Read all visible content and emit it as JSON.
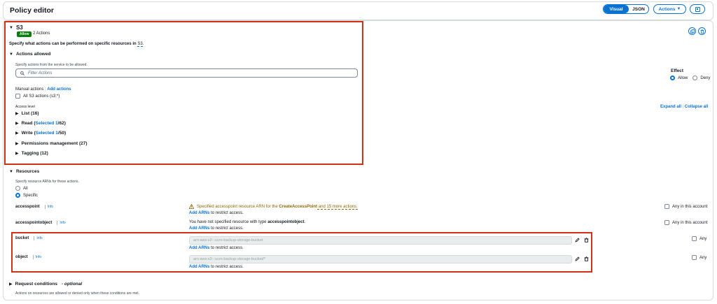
{
  "header": {
    "title": "Policy editor",
    "mode_visual": "Visual",
    "mode_json": "JSON",
    "actions_label": "Actions"
  },
  "service": {
    "name": "S3",
    "effect_badge": "Allow",
    "actions_count": "2 Actions",
    "description_prefix": "Specify what actions can be performed on specific resources in ",
    "description_service": "S3",
    "description_suffix": "."
  },
  "actions_allowed": {
    "heading": "Actions allowed",
    "hint": "Specify actions from the service to be allowed.",
    "filter_placeholder": "Filter Actions",
    "manual_label": "Manual actions",
    "add_actions": "Add actions",
    "all_actions": "All S3 actions (s3:*)",
    "access_level": "Access level",
    "expand_all": "Expand all",
    "collapse_all": "Collapse all",
    "groups": [
      {
        "pre": "List (16)",
        "sel": "",
        "post": ""
      },
      {
        "pre": "Read (",
        "sel": "Selected 1",
        "post": "/62)"
      },
      {
        "pre": "Write (",
        "sel": "Selected 1",
        "post": "/50)"
      },
      {
        "pre": "Permissions management (27)",
        "sel": "",
        "post": ""
      },
      {
        "pre": "Tagging (12)",
        "sel": "",
        "post": ""
      }
    ]
  },
  "effect": {
    "label": "Effect",
    "allow": "Allow",
    "deny": "Deny"
  },
  "resources": {
    "heading": "Resources",
    "hint": "Specify resource ARNs for these actions.",
    "opt_all": "All",
    "opt_specific": "Specific",
    "info": "Info",
    "add_arns": "Add ARNs",
    "restrict": " to restrict access.",
    "any_account": "Any in this account",
    "any": "Any",
    "accesspoint": {
      "name": "accesspoint",
      "warn_pre": "Specified accesspoint resource ARN for the ",
      "warn_bold": "CreateAccessPoint",
      "warn_post": " and 15 more actions."
    },
    "accesspointobject": {
      "name": "accesspointobject",
      "msg_pre": "You have not specified resource with type ",
      "msg_bold": "accesspointobject",
      "msg_post": "."
    },
    "bucket": {
      "name": "bucket",
      "value": "arn:aws:s3:::ucm-backup-storage-bucket"
    },
    "object": {
      "name": "object",
      "value": "arn:aws:s3:::ucm-backup-storage-bucket/*"
    }
  },
  "conditions": {
    "heading": "Request conditions",
    "optional": "- optional",
    "hint": "Actions on resources are allowed or denied only when these conditions are met."
  },
  "colors": {
    "primary": "#0972d3",
    "allow_badge": "#037f0c",
    "highlight": "#d13212",
    "warning": "#8d6605"
  }
}
